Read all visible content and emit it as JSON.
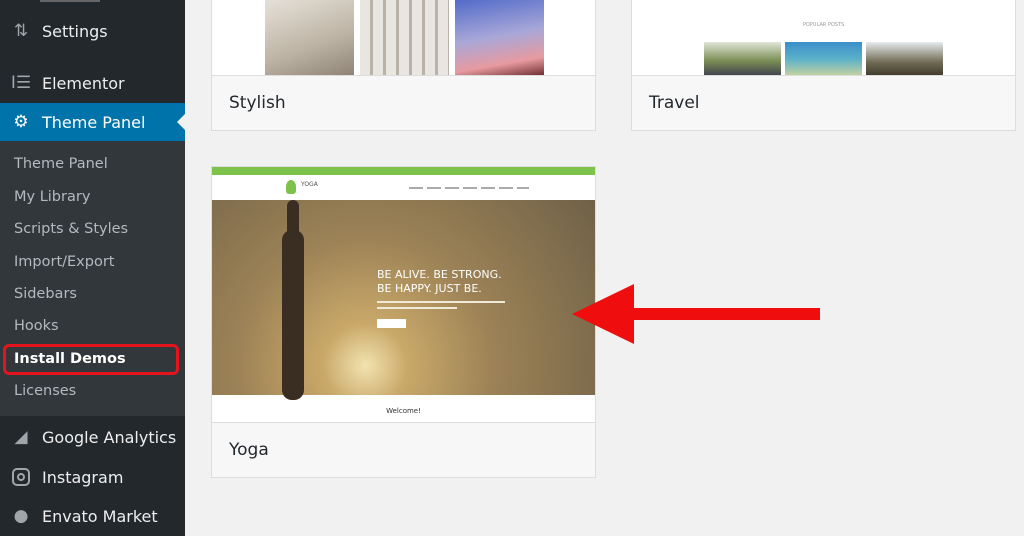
{
  "sidebar": {
    "items": [
      {
        "label": "Settings",
        "icon": "settings-icon"
      },
      {
        "label": "Elementor",
        "icon": "elementor-icon"
      },
      {
        "label": "Theme Panel",
        "icon": "gear-icon",
        "active": true
      },
      {
        "label": "Google Analytics",
        "icon": "analytics-icon"
      },
      {
        "label": "Instagram",
        "icon": "instagram-icon"
      },
      {
        "label": "Envato Market",
        "icon": "envato-icon"
      }
    ],
    "submenu": [
      "Theme Panel",
      "My Library",
      "Scripts & Styles",
      "Import/Export",
      "Sidebars",
      "Hooks",
      "Install Demos",
      "Licenses"
    ],
    "current_submenu": "Install Demos"
  },
  "demos": [
    {
      "name": "Stylish"
    },
    {
      "name": "Travel",
      "preview_heading": "POPULAR POSTS"
    },
    {
      "name": "Yoga",
      "preview_logo": "YOGA",
      "preview_headline_1": "BE ALIVE. BE STRONG.",
      "preview_headline_2": "BE HAPPY. JUST BE.",
      "preview_welcome": "Welcome!"
    }
  ],
  "colors": {
    "sidebar": "#23282d",
    "active": "#0073aa",
    "highlight": "#e3141b",
    "yoga_green": "#7dc24b"
  }
}
